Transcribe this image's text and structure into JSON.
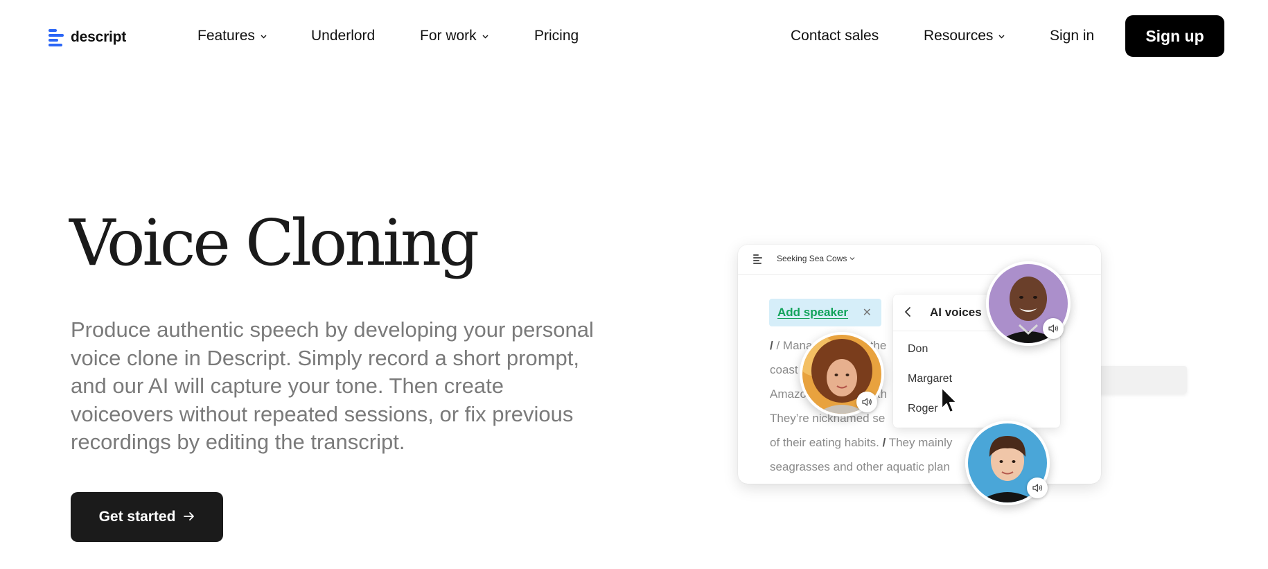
{
  "brand": {
    "name": "descript",
    "accent": "#2b66f6"
  },
  "nav": {
    "left": [
      {
        "label": "Features",
        "dropdown": true
      },
      {
        "label": "Underlord",
        "dropdown": false
      },
      {
        "label": "For work",
        "dropdown": true
      },
      {
        "label": "Pricing",
        "dropdown": false
      }
    ],
    "right": [
      {
        "label": "Contact sales",
        "dropdown": false
      },
      {
        "label": "Resources",
        "dropdown": true
      },
      {
        "label": "Sign in",
        "dropdown": false
      }
    ],
    "signup_label": "Sign up"
  },
  "hero": {
    "title": "Voice Cloning",
    "description": "Produce authentic speech by developing your personal voice clone in Descript. Simply record a short prompt, and our AI will capture your tone. Then create voiceovers without repeated sessions, or fix previous recordings by editing the transcript.",
    "cta_label": "Get started"
  },
  "illustration": {
    "doc_title": "Seeking Sea Cows",
    "speaker_label": "Add speaker",
    "transcript_lines": [
      "/ Mana",
      "coast",
      "Amazo",
      "They’re nicknamed se",
      "of their eating habits.",
      "seagrasses and other aquatic plan"
    ],
    "transcript_tail": {
      "line1_suffix": "it the",
      "line2_suffix": "st",
      "line3_suffix": "th",
      "line5_marker": "/",
      "line5_suffix": "They mainly"
    },
    "voices_panel": {
      "title": "AI voices",
      "options": [
        "Don",
        "Margaret",
        "Roger"
      ]
    }
  }
}
